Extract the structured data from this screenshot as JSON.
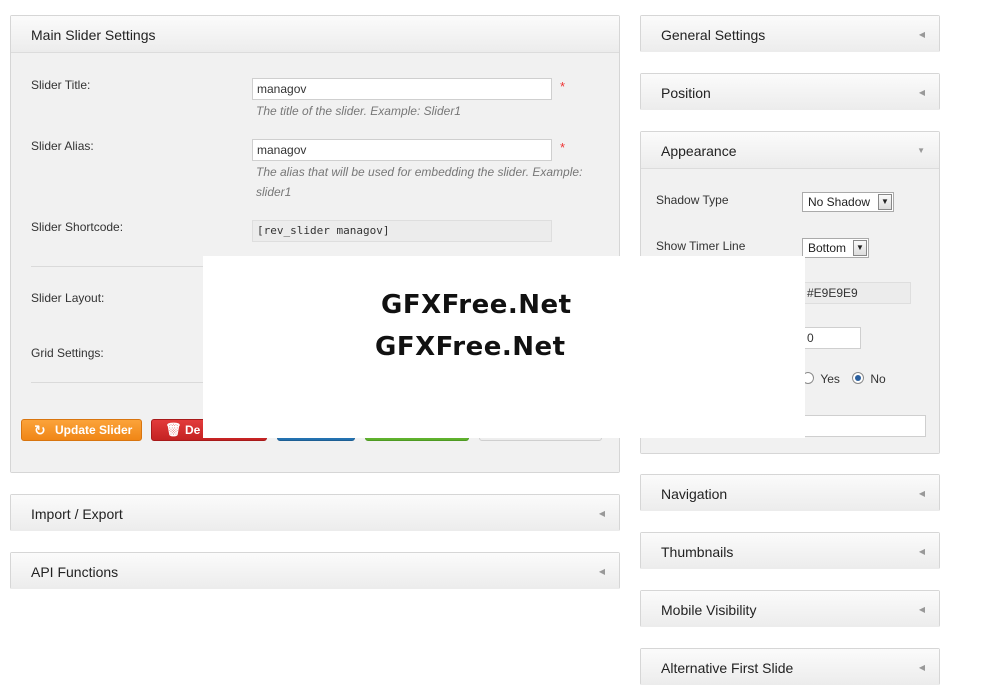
{
  "main_settings": {
    "title": "Main Slider Settings",
    "slider_title_label": "Slider Title:",
    "slider_title_value": "managov",
    "slider_title_hint": "The title of the slider. Example: Slider1",
    "slider_alias_label": "Slider Alias:",
    "slider_alias_value": "managov",
    "slider_alias_hint": "The alias that will be used for embedding the slider. Example: slider1",
    "slider_shortcode_label": "Slider Shortcode:",
    "slider_shortcode_value": "[rev_slider managov]",
    "required_mark": "*",
    "slider_layout_label": "Slider Layout:",
    "grid_settings_label": "Grid Settings:",
    "update_button": "Update Slider",
    "delete_button": "De"
  },
  "import_export": {
    "title": "Import / Export"
  },
  "api_functions": {
    "title": "API Functions"
  },
  "right_panels": {
    "general": "General Settings",
    "position": "Position",
    "appearance": "Appearance",
    "navigation": "Navigation",
    "thumbnails": "Thumbnails",
    "mobile_visibility": "Mobile Visibility",
    "alternative_first_slide": "Alternative First Slide"
  },
  "appearance": {
    "shadow_type_label": "Shadow Type",
    "shadow_type_value": "No Shadow",
    "show_timer_line_label": "Show Timer Line",
    "show_timer_line_value": "Bottom",
    "color_value": "#E9E9E9",
    "number_value": "0",
    "radio_yes": "Yes",
    "radio_no": "No",
    "radio_selected": "No"
  },
  "watermark": {
    "line1": "GFXFree.Net",
    "line2": "GFXFree.Net"
  },
  "colors": {
    "update_button": "#f7931e",
    "delete_button": "#d22a2a",
    "blue_button": "#2a7ab8",
    "green_button": "#6cbf3a"
  }
}
